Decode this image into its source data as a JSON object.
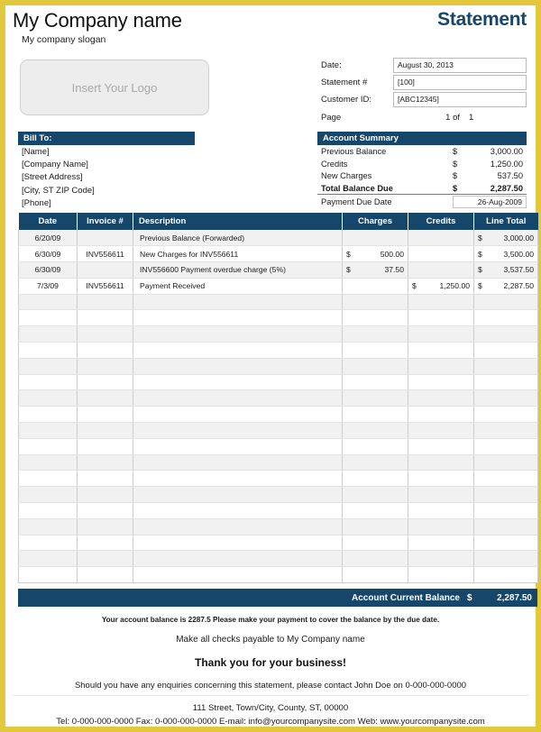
{
  "theme": {
    "border_color": "#e3c73d",
    "accent_color": "#17466b",
    "row_alt_color": "#f1f1f1"
  },
  "header": {
    "company_name": "My Company name",
    "company_slogan": "My company slogan",
    "doc_title": "Statement",
    "logo_placeholder": "Insert Your Logo",
    "fields": [
      {
        "label": "Date:",
        "value": "August 30, 2013"
      },
      {
        "label": "Statement #",
        "value": "[100]"
      },
      {
        "label": "Customer ID:",
        "value": "[ABC12345]"
      }
    ],
    "page_label": "Page",
    "page_of": "1 of",
    "page_total": "1"
  },
  "bill_to": {
    "title": "Bill To:",
    "lines": [
      "[Name]",
      "[Company Name]",
      "[Street Address]",
      "[City, ST  ZIP Code]",
      "[Phone]"
    ]
  },
  "account_summary": {
    "title": "Account Summary",
    "rows": [
      {
        "label": "Previous Balance",
        "currency": "$",
        "value": "3,000.00"
      },
      {
        "label": "Credits",
        "currency": "$",
        "value": "1,250.00"
      },
      {
        "label": "New Charges",
        "currency": "$",
        "value": "537.50"
      },
      {
        "label": "Total Balance Due",
        "currency": "$",
        "value": "2,287.50"
      }
    ],
    "due_label": "Payment Due Date",
    "due_value": "26-Aug-2009"
  },
  "table": {
    "columns": [
      "Date",
      "Invoice #",
      "Description",
      "Charges",
      "Credits",
      "Line Total"
    ],
    "rows": [
      {
        "date": "6/20/09",
        "invoice": "",
        "description": "Previous Balance (Forwarded)",
        "charge_cur": "",
        "charge": "",
        "credit_cur": "",
        "credit": "",
        "total_cur": "$",
        "total": "3,000.00"
      },
      {
        "date": "6/30/09",
        "invoice": "INV556611",
        "description": "New Charges for INV556611",
        "charge_cur": "$",
        "charge": "500.00",
        "credit_cur": "",
        "credit": "",
        "total_cur": "$",
        "total": "3,500.00"
      },
      {
        "date": "6/30/09",
        "invoice": "",
        "description": "INV556600 Payment overdue charge (5%)",
        "charge_cur": "$",
        "charge": "37.50",
        "credit_cur": "",
        "credit": "",
        "total_cur": "$",
        "total": "3,537.50"
      },
      {
        "date": "7/3/09",
        "invoice": "INV556611",
        "description": "Payment Received",
        "charge_cur": "",
        "charge": "",
        "credit_cur": "$",
        "credit": "1,250.00",
        "total_cur": "$",
        "total": "2,287.50"
      }
    ],
    "empty_row_count": 18
  },
  "balance_bar": {
    "label": "Account Current Balance",
    "currency": "$",
    "value": "2,287.50"
  },
  "footer": {
    "notice": "Your account balance is 2287.5 Please make your payment to cover the balance by the due date.",
    "checks": "Make all checks payable to My Company name",
    "thanks": "Thank you for your business!",
    "enquiries": "Should you have any enquiries concerning this statement, please contact John Doe on 0-000-000-0000",
    "address": "111 Street, Town/City, County, ST, 00000",
    "contact": "Tel: 0-000-000-0000 Fax: 0-000-000-0000 E-mail: info@yourcompanysite.com Web: www.yourcompanysite.com"
  }
}
